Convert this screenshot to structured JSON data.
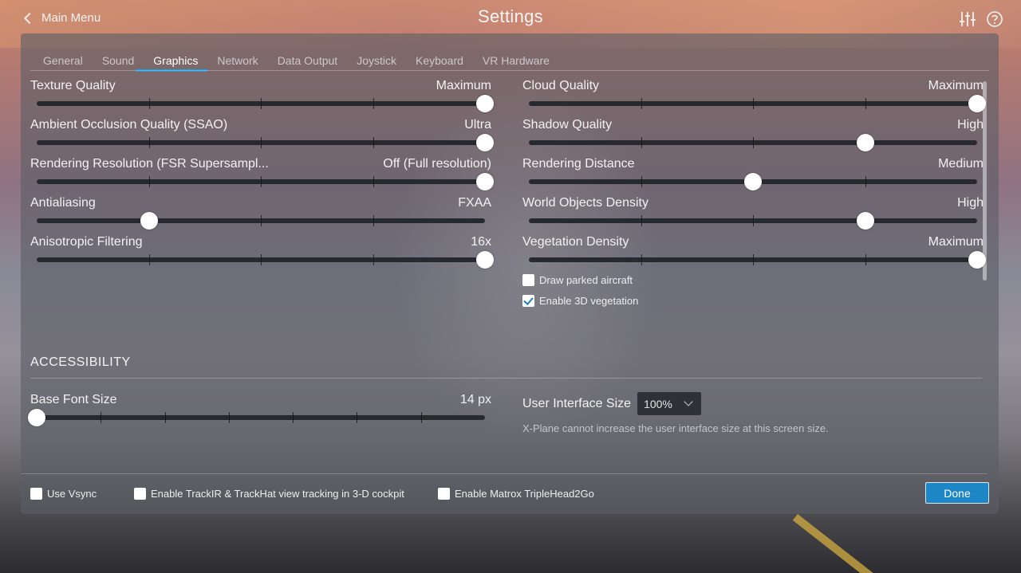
{
  "header": {
    "back_label": "Main Menu",
    "title": "Settings",
    "icons": [
      "sliders-icon",
      "help-icon"
    ]
  },
  "tabs": [
    {
      "label": "General",
      "active": false
    },
    {
      "label": "Sound",
      "active": false
    },
    {
      "label": "Graphics",
      "active": true
    },
    {
      "label": "Network",
      "active": false
    },
    {
      "label": "Data Output",
      "active": false
    },
    {
      "label": "Joystick",
      "active": false
    },
    {
      "label": "Keyboard",
      "active": false
    },
    {
      "label": "VR Hardware",
      "active": false
    }
  ],
  "left_settings": [
    {
      "label": "Texture Quality",
      "value": "Maximum",
      "level": 1.0,
      "steps": 4
    },
    {
      "label": "Ambient Occlusion Quality (SSAO)",
      "value": "Ultra",
      "level": 1.0,
      "steps": 4
    },
    {
      "label": "Rendering Resolution (FSR Supersampl...",
      "value": "Off (Full resolution)",
      "level": 1.0,
      "steps": 4
    },
    {
      "label": "Antialiasing",
      "value": "FXAA",
      "level": 0.25,
      "steps": 4
    },
    {
      "label": "Anisotropic Filtering",
      "value": "16x",
      "level": 1.0,
      "steps": 4
    }
  ],
  "right_settings": [
    {
      "label": "Cloud Quality",
      "value": "Maximum",
      "level": 1.0,
      "steps": 4
    },
    {
      "label": "Shadow Quality",
      "value": "High",
      "level": 0.75,
      "steps": 4
    },
    {
      "label": "Rendering Distance",
      "value": "Medium",
      "level": 0.5,
      "steps": 4
    },
    {
      "label": "World Objects Density",
      "value": "High",
      "level": 0.75,
      "steps": 4
    },
    {
      "label": "Vegetation Density",
      "value": "Maximum",
      "level": 1.0,
      "steps": 4
    }
  ],
  "graphics_checks": [
    {
      "label": "Draw parked aircraft",
      "checked": false
    },
    {
      "label": "Enable 3D vegetation",
      "checked": true
    }
  ],
  "accessibility": {
    "heading": "ACCESSIBILITY",
    "font_size_label": "Base Font Size",
    "font_size_value": "14 px",
    "font_size_level": 0.0,
    "font_size_steps": 7,
    "ui_size_label": "User Interface Size",
    "ui_size_value": "100%",
    "note": "X-Plane cannot increase the user interface size at this screen size."
  },
  "footer": {
    "checks": [
      {
        "label": "Use Vsync",
        "checked": false
      },
      {
        "label": "Enable TrackIR & TrackHat view tracking in 3-D cockpit",
        "checked": false
      },
      {
        "label": "Enable Matrox TripleHead2Go",
        "checked": false
      }
    ],
    "done_label": "Done"
  },
  "colors": {
    "accent": "#1f86c6",
    "tab_underline": "#2f9ad6",
    "track": "#262a2e"
  }
}
